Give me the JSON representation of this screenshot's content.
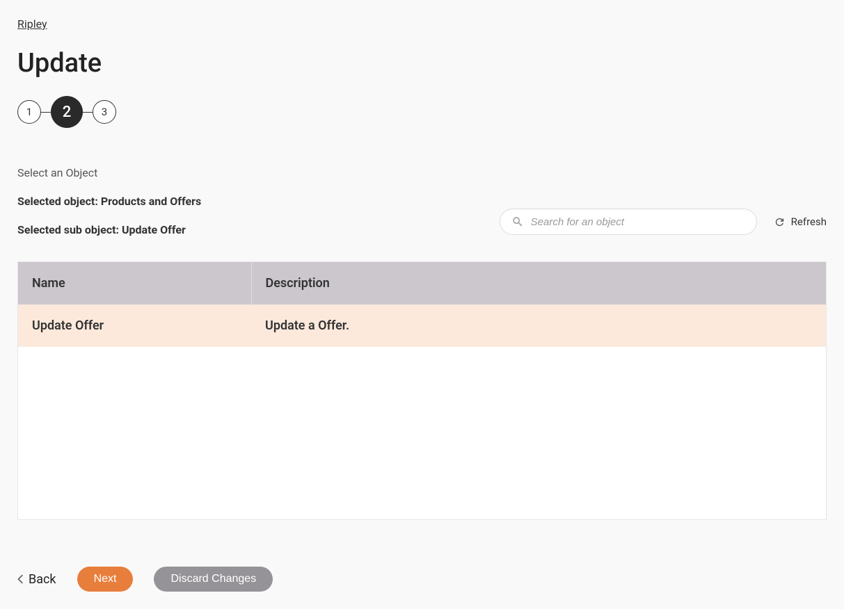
{
  "breadcrumb": {
    "root": "Ripley"
  },
  "page": {
    "title": "Update"
  },
  "stepper": {
    "steps": [
      "1",
      "2",
      "3"
    ],
    "active_index": 1
  },
  "section": {
    "label": "Select an Object",
    "selected_object_label": "Selected object: Products and Offers",
    "selected_sub_object_label": "Selected sub object: Update Offer"
  },
  "search": {
    "placeholder": "Search for an object"
  },
  "refresh": {
    "label": "Refresh"
  },
  "table": {
    "headers": {
      "name": "Name",
      "description": "Description"
    },
    "rows": [
      {
        "name": "Update Offer",
        "description": "Update a Offer."
      }
    ]
  },
  "footer": {
    "back": "Back",
    "next": "Next",
    "discard": "Discard Changes"
  }
}
